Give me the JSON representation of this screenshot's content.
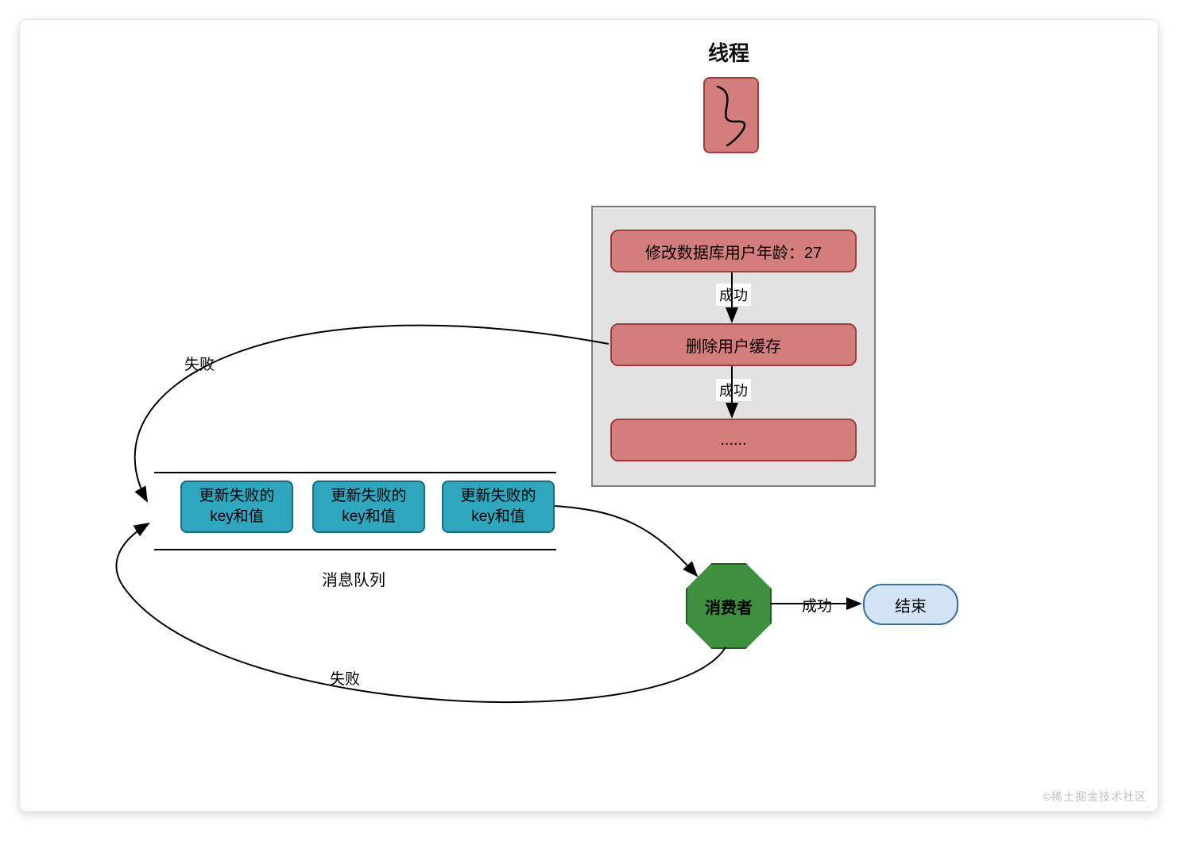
{
  "thread_title": "线程",
  "process": {
    "step_modify_db": "修改数据库用户年龄：27",
    "step_delete_cache": "删除用户缓存",
    "step_more": "......",
    "edge_success1": "成功",
    "edge_success2": "成功"
  },
  "queue": {
    "item": "更新失败的\nkey和值",
    "label": "消息队列"
  },
  "consumer_label": "消费者",
  "end_label": "结束",
  "labels": {
    "fail": "失败",
    "success": "成功"
  },
  "watermark": "©稀土掘金技术社区",
  "chart_data": {
    "type": "diagram",
    "title": "线程",
    "nodes": [
      {
        "id": "thread",
        "type": "start",
        "label": "线程"
      },
      {
        "id": "modify_db",
        "type": "step",
        "label": "修改数据库用户年龄：27"
      },
      {
        "id": "delete_cache",
        "type": "step",
        "label": "删除用户缓存"
      },
      {
        "id": "more",
        "type": "step",
        "label": "......"
      },
      {
        "id": "queue",
        "type": "queue",
        "label": "消息队列",
        "items": [
          "更新失败的key和值",
          "更新失败的key和值",
          "更新失败的key和值"
        ]
      },
      {
        "id": "consumer",
        "type": "process",
        "label": "消费者"
      },
      {
        "id": "end",
        "type": "terminal",
        "label": "结束"
      }
    ],
    "edges": [
      {
        "from": "modify_db",
        "to": "delete_cache",
        "label": "成功"
      },
      {
        "from": "delete_cache",
        "to": "more",
        "label": "成功"
      },
      {
        "from": "delete_cache",
        "to": "queue",
        "label": "失败"
      },
      {
        "from": "queue",
        "to": "consumer",
        "label": ""
      },
      {
        "from": "consumer",
        "to": "end",
        "label": "成功"
      },
      {
        "from": "consumer",
        "to": "queue",
        "label": "失败"
      }
    ]
  }
}
